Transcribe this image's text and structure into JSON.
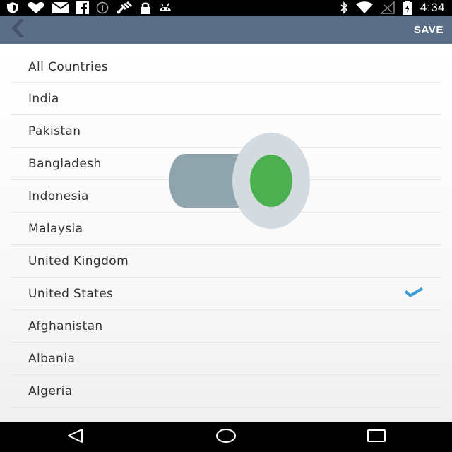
{
  "status_bar": {
    "time": "4:34",
    "left_icons": [
      "shield-icon",
      "heart-icon",
      "mail-icon",
      "facebook-icon",
      "circle-info-icon",
      "satellite-icon",
      "lock-icon",
      "android-icon"
    ],
    "right_icons": [
      "bluetooth-icon",
      "wifi-icon",
      "no-signal-icon",
      "battery-icon"
    ]
  },
  "toolbar": {
    "back_icon": "chevron-left-icon",
    "save_label": "SAVE",
    "color": "#5b6e87"
  },
  "countries": [
    {
      "label": "All Countries",
      "selected": false
    },
    {
      "label": "India",
      "selected": false
    },
    {
      "label": "Pakistan",
      "selected": false
    },
    {
      "label": "Bangladesh",
      "selected": false
    },
    {
      "label": "Indonesia",
      "selected": false
    },
    {
      "label": "Malaysia",
      "selected": false
    },
    {
      "label": "United Kingdom",
      "selected": false
    },
    {
      "label": "United States",
      "selected": true
    },
    {
      "label": "Afghanistan",
      "selected": false
    },
    {
      "label": "Albania",
      "selected": false
    },
    {
      "label": "Algeria",
      "selected": false
    }
  ],
  "check_color": "#3d9bd6",
  "overlay_icon": "toggle-switch-icon",
  "nav_bar": {
    "icons": [
      "back-triangle-icon",
      "home-circle-icon",
      "recents-square-icon"
    ]
  }
}
